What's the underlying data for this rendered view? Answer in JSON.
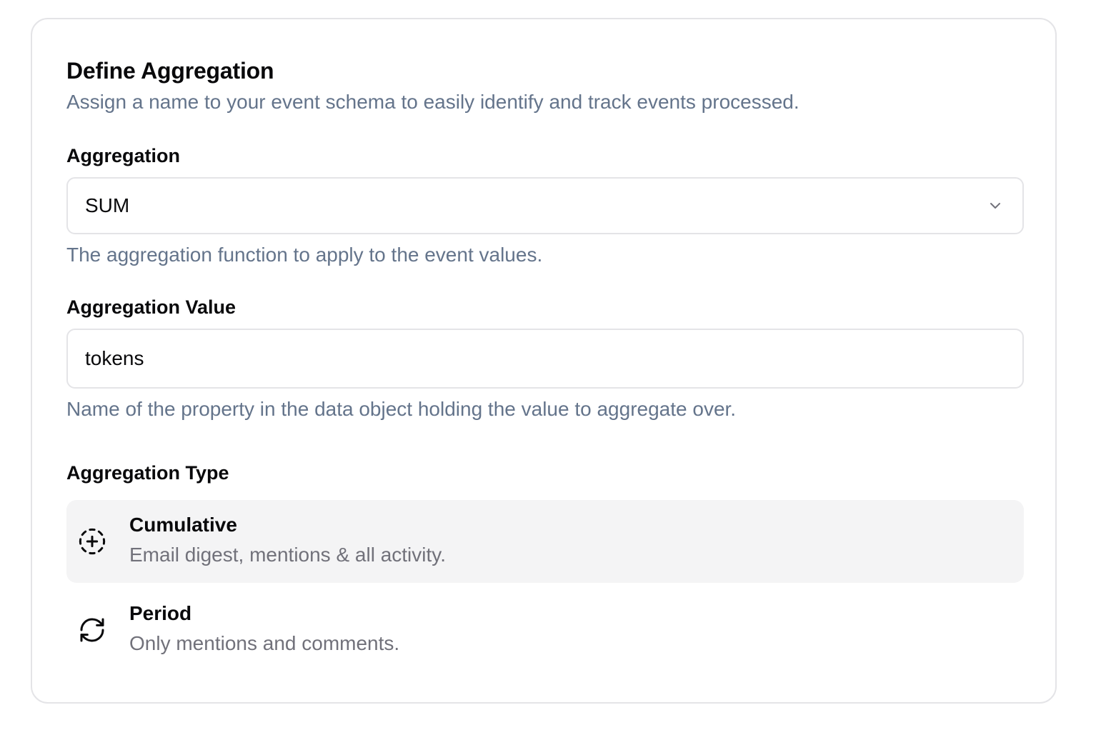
{
  "header": {
    "title": "Define Aggregation",
    "subtitle": "Assign a name to your event schema to easily identify and track events processed."
  },
  "aggregation": {
    "label": "Aggregation",
    "selected_value": "SUM",
    "help": "The aggregation function to apply to the event values."
  },
  "aggregation_value": {
    "label": "Aggregation Value",
    "value": "tokens",
    "help": "Name of the property in the data object holding the value to aggregate over."
  },
  "aggregation_type": {
    "label": "Aggregation Type",
    "options": [
      {
        "title": "Cumulative",
        "description": "Email digest, mentions & all activity.",
        "icon": "circle-dashed-plus-icon",
        "selected": true
      },
      {
        "title": "Period",
        "description": "Only mentions and comments.",
        "icon": "refresh-icon",
        "selected": false
      }
    ]
  },
  "colors": {
    "text": "#09090b",
    "muted": "#64748b",
    "border": "#e4e4e7",
    "selected_bg": "#f4f4f5"
  }
}
